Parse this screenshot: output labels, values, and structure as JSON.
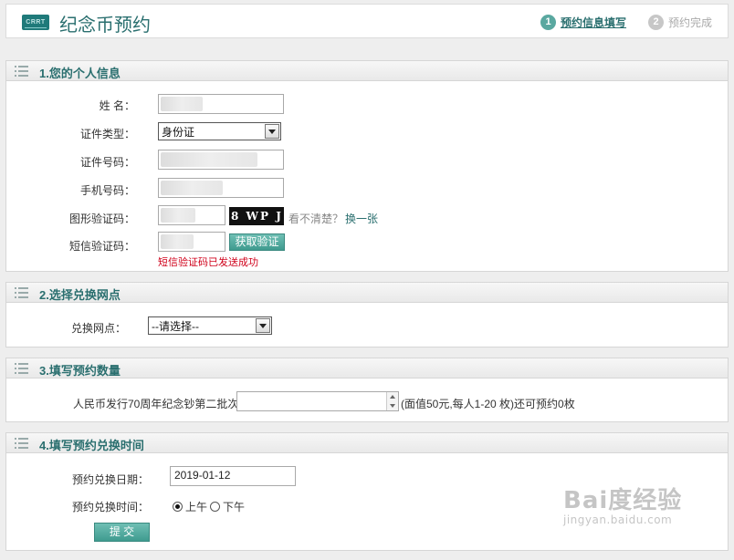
{
  "header": {
    "logo_text": "CRRT",
    "title": "纪念币预约",
    "steps": [
      {
        "num": "1",
        "label": "预约信息填写"
      },
      {
        "num": "2",
        "label": "预约完成"
      }
    ]
  },
  "section1": {
    "title": "1.您的个人信息",
    "name_label": "姓  名：",
    "id_type_label": "证件类型：",
    "id_type_value": "身份证",
    "id_number_label": "证件号码：",
    "phone_label": "手机号码：",
    "captcha_label": "图形验证码：",
    "captcha_text": "8 WP J",
    "captcha_hint": "看不清楚？",
    "captcha_refresh": "换一张",
    "sms_label": "短信验证码：",
    "sms_button": "获取验证码",
    "sms_status": "短信验证码已发送成功"
  },
  "section2": {
    "title": "2.选择兑换网点",
    "outlet_label": "兑换网点：",
    "outlet_value": "--请选择--"
  },
  "section3": {
    "title": "3.填写预约数量",
    "coin_label": "人民币发行70周年纪念钞第二批次",
    "coin_note": "(面值50元,每人1-20 枚)还可预约0枚",
    "quantity": ""
  },
  "section4": {
    "title": "4.填写预约兑换时间",
    "date_label": "预约兑换日期：",
    "date_value": "2019-01-12",
    "time_label": "预约兑换时间：",
    "am_label": "上午",
    "pm_label": "下午",
    "submit_label": "提 交"
  },
  "watermark": {
    "main": "Bai度经验",
    "sub": "jingyan.baidu.com"
  }
}
